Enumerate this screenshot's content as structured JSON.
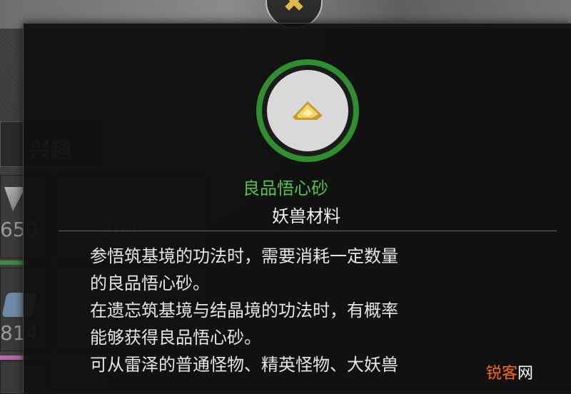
{
  "background": {
    "interest_tab_label": "兴趣",
    "slot_counts": [
      "650",
      "814",
      "864"
    ]
  },
  "tooltip": {
    "item_icon": "sand-pile-icon",
    "item_name": "良品悟心砂",
    "item_name_color": "#4fc54a",
    "rarity_ring_color": "#2f8f2f",
    "item_type": "妖兽材料",
    "description_lines": [
      "参悟筑基境的功法时，需要消耗一定数量",
      "的良品悟心砂。",
      "在遗忘筑基境与结晶境的功法时，有概率",
      "能够获得良品悟心砂。",
      "可从雷泽的普通怪物、精英怪物、大妖兽"
    ]
  },
  "watermark": {
    "brand": "锐客",
    "suffix": "网"
  }
}
